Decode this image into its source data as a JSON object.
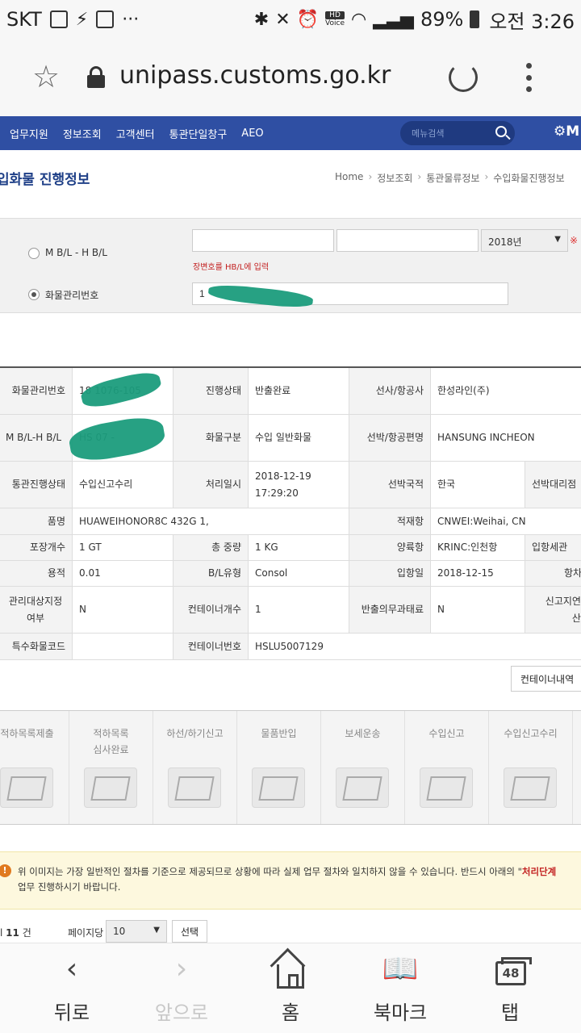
{
  "status_bar": {
    "carrier": "SKT",
    "battery": "89%",
    "time": "오전 3:26",
    "hd_label": "HD",
    "voice_label": "Voice"
  },
  "browser": {
    "url": "unipass.customs.go.kr"
  },
  "site_nav": {
    "items": [
      "업무지원",
      "정보조회",
      "고객센터",
      "통관단일창구",
      "AEO"
    ],
    "search_placeholder": "메뉴검색",
    "my_menu": "M"
  },
  "page": {
    "title": "입화물 진행정보",
    "breadcrumb": [
      "Home",
      "정보조회",
      "통관물류정보",
      "수입화물진행정보"
    ]
  },
  "search_form": {
    "option_bl": "M B/L - H B/L",
    "option_cargo": "화물관리번호",
    "bl_input1": "",
    "bl_input2": "",
    "year_select": "2018년",
    "hint": "장변호를 HB/L에 입력",
    "cargo_input": "1"
  },
  "details": {
    "rows": [
      {
        "cells": [
          {
            "type": "lab",
            "text": "화물관리번호"
          },
          {
            "type": "val",
            "text": "18  1076-105"
          },
          {
            "type": "lab",
            "text": "진행상태"
          },
          {
            "type": "val",
            "text": "반출완료"
          },
          {
            "type": "lab",
            "text": "선사/항공사"
          },
          {
            "type": "val",
            "text": "한성라인(주)"
          }
        ]
      },
      {
        "cells": [
          {
            "type": "lab",
            "text": "M B/L-H B/L"
          },
          {
            "type": "val",
            "text": "HS  07 -"
          },
          {
            "type": "lab",
            "text": "화물구분"
          },
          {
            "type": "val",
            "text": "수입 일반화물"
          },
          {
            "type": "lab",
            "text": "선박/항공편명"
          },
          {
            "type": "val",
            "text": "HANSUNG INCHEON"
          }
        ]
      },
      {
        "cells": [
          {
            "type": "lab",
            "text": "통관진행상태"
          },
          {
            "type": "val",
            "text": "수입신고수리"
          },
          {
            "type": "lab",
            "text": "처리일시"
          },
          {
            "type": "val",
            "text": "2018-12-19 17:29:20"
          },
          {
            "type": "lab",
            "text": "선박국적"
          },
          {
            "type": "val",
            "text": "한국"
          },
          {
            "type": "lab",
            "text": "선박대리점"
          }
        ]
      },
      {
        "cells": [
          {
            "type": "lab",
            "text": "품명"
          },
          {
            "type": "val",
            "text": "HUAWEIHONOR8C 432G 1,"
          },
          {
            "type": "lab",
            "text": "적재항"
          },
          {
            "type": "val",
            "text": "CNWEI:Weihai, CN"
          }
        ]
      },
      {
        "cells": [
          {
            "type": "lab",
            "text": "포장개수"
          },
          {
            "type": "val",
            "text": "1 GT"
          },
          {
            "type": "lab",
            "text": "총 중량"
          },
          {
            "type": "val",
            "text": "1 KG"
          },
          {
            "type": "lab",
            "text": "양륙항"
          },
          {
            "type": "val",
            "text": "KRINC:인천항"
          },
          {
            "type": "lab",
            "text": "입항세관"
          }
        ]
      },
      {
        "cells": [
          {
            "type": "lab",
            "text": "용적"
          },
          {
            "type": "val",
            "text": "0.01"
          },
          {
            "type": "lab",
            "text": "B/L유형"
          },
          {
            "type": "val",
            "text": "Consol"
          },
          {
            "type": "lab",
            "text": "입항일"
          },
          {
            "type": "val",
            "text": "2018-12-15"
          },
          {
            "type": "lab",
            "text": "항차"
          }
        ]
      },
      {
        "cells": [
          {
            "type": "lab",
            "text": "관리대상지정여부"
          },
          {
            "type": "val",
            "text": "N"
          },
          {
            "type": "lab",
            "text": "컨테이너개수"
          },
          {
            "type": "val",
            "text": "1"
          },
          {
            "type": "lab",
            "text": "반출의무과태료"
          },
          {
            "type": "val",
            "text": "N"
          },
          {
            "type": "lab",
            "text": "신고지연가산세"
          }
        ]
      },
      {
        "cells": [
          {
            "type": "lab",
            "text": "특수화물코드"
          },
          {
            "type": "val",
            "text": ""
          },
          {
            "type": "lab",
            "text": "컨테이너번호"
          },
          {
            "type": "val",
            "text": "HSLU5007129"
          }
        ]
      }
    ],
    "container_button": "컨테이너내역"
  },
  "steps": [
    "적하목록제출",
    "적하목록\n심사완료",
    "하선/하기신고",
    "물품반입",
    "보세운송",
    "수입신고",
    "수입신고수리"
  ],
  "notice": {
    "line1_a": "위 이미지는 가장 일반적인 절차를 기준으로 제공되므로 상황에 따라 실제 업무 절차와 일치하지 않을 수 있습니다. 반드시 아래의 \"",
    "line1_b": "처리단계",
    "line2": "업무 진행하시기 바랍니다."
  },
  "pager": {
    "total_prefix": "l",
    "total_count": "11",
    "total_suffix": "건",
    "per_page_label": "페이지당",
    "per_page_value": "10",
    "select_button": "선택"
  },
  "bottom_nav": {
    "back": "뒤로",
    "forward": "앞으로",
    "home": "홈",
    "bookmarks": "북마크",
    "tabs": "탭",
    "tab_count": "48"
  }
}
